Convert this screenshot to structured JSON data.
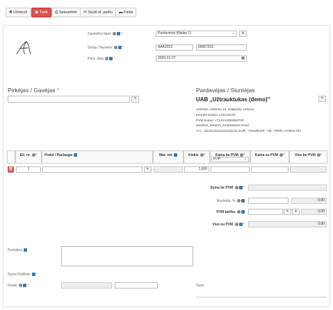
{
  "toolbar": {
    "close_label": "Uždaryti",
    "continue_label": "Tęsti",
    "print_label": "Spausdinti",
    "email_label": "Siųsti el. paštu",
    "files_label": "Failai"
  },
  "form": {
    "invoice_type_label": "Sąskaitos tipas",
    "invoice_type_value": "Pardavimai (filialas 1)",
    "series_number_label": "Serija / Numeris",
    "series_value": "AAA2022",
    "number_value": "96867202",
    "sale_date_label": "Pard. data",
    "sale_date_value": "2026-01-27"
  },
  "buyer": {
    "title": "Pirkėjas / Gavėjas"
  },
  "seller": {
    "title": "Pardavėjas / Siuntėjas",
    "name": "UAB „Užtrauktukas (demo)\"",
    "address": "Adresas: Debesų 13, Klaipėda, Lietuva",
    "company_code": "Įmonės kodas: 123123123",
    "vat_code": "PVM kodas: LT1XXX000960700",
    "email": "autotest_temp15_b1@sitepro.email",
    "bank_account": "A.s.: 111111111111111111111 EUR; \"Swedbank\", AB, 73000, HABALT22"
  },
  "table": {
    "col_no": "Eil. nr.",
    "col_product": "Prekė / Paslauga",
    "col_unit": "Mat. vnt",
    "col_qty": "Kiekis",
    "col_price_ex_vat": "Kaina be PVM",
    "currency": "EUR",
    "col_price_vat": "Kaina su PVM",
    "col_total_ex_vat": "Viso be PVM",
    "row": {
      "no": "1",
      "qty": "1,000"
    }
  },
  "totals": {
    "sum_ex_vat_label": "Suma be PVM",
    "discount_label": "Nuolaida, %",
    "discount_value": "0,00",
    "vat_rate_label": "PVM tarifas",
    "vat_rate_value": "0,00",
    "total_vat_label": "Viso su PVM",
    "total_vat_value": "0,00"
  },
  "footer": {
    "notes_label": "Pastabos",
    "amount_words_label": "Suma žodžiais",
    "issued_by_label": "Išrašė",
    "received_by_label": "Gavo"
  },
  "colors": {
    "accent_red": "#d9534f",
    "info_blue": "#337ab7"
  }
}
